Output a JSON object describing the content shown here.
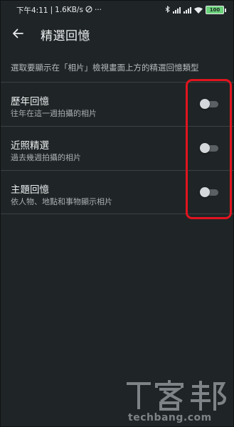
{
  "status_bar": {
    "time": "下午4:11",
    "network_speed": "1.6KB/s",
    "dnd_icon": "do-not-disturb-icon",
    "more": "···",
    "battery": "100"
  },
  "header": {
    "back_icon": "arrow-left-icon",
    "title": "精選回憶"
  },
  "description": "選取要顯示在「相片」檢視畫面上方的精選回憶類型",
  "settings": [
    {
      "title": "歷年回憶",
      "subtitle": "往年在這一週拍攝的相片",
      "enabled": false
    },
    {
      "title": "近照精選",
      "subtitle": "過去幾週拍攝的相片",
      "enabled": false
    },
    {
      "title": "主題回憶",
      "subtitle": "依人物、地點和事物顯示相片",
      "enabled": false
    }
  ],
  "watermark": {
    "logo_text": "T客邦",
    "url": "techbang.com"
  },
  "colors": {
    "background": "#1f2526",
    "divider": "#3b4143",
    "highlight": "#e1141f",
    "toggle_off_thumb": "#d5d8da",
    "toggle_off_track": "#5a6063"
  }
}
